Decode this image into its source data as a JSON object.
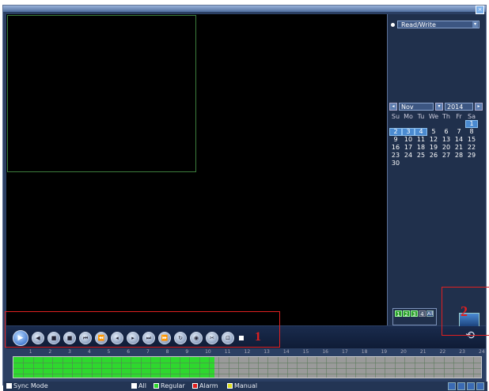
{
  "sidebar": {
    "mode_select": "Read/Write",
    "calendar": {
      "month": "Nov",
      "year": "2014",
      "weekdays": [
        "Su",
        "Mo",
        "Tu",
        "We",
        "Th",
        "Fr",
        "Sa"
      ],
      "days": [
        "1",
        "2",
        "3",
        "4",
        "5",
        "6",
        "7",
        "8",
        "9",
        "10",
        "11",
        "12",
        "13",
        "14",
        "15",
        "16",
        "17",
        "18",
        "19",
        "20",
        "21",
        "22",
        "23",
        "24",
        "25",
        "26",
        "27",
        "28",
        "29",
        "30"
      ],
      "highlighted_days": [
        "1",
        "2",
        "3",
        "4"
      ]
    },
    "channels": [
      "1",
      "2",
      "3",
      "4"
    ],
    "channels_all": "All"
  },
  "controls": {
    "buttons": [
      "play-icon",
      "slow-icon",
      "pause-icon",
      "stop-icon",
      "prev-file-icon",
      "fast-back-icon",
      "frame-back-icon",
      "frame-forward-icon",
      "next-file-icon",
      "fast-forward-icon",
      "loop-icon",
      "snapshot-icon",
      "cut-icon",
      "save-icon"
    ]
  },
  "timeline": {
    "hours": [
      "0",
      "1",
      "2",
      "3",
      "4",
      "5",
      "6",
      "7",
      "8",
      "9",
      "10",
      "11",
      "12",
      "13",
      "14",
      "15",
      "16",
      "17",
      "18",
      "19",
      "20",
      "21",
      "22",
      "23",
      "24"
    ],
    "recorded_fraction": 0.43
  },
  "legend": {
    "sync": "Sync Mode",
    "all": "All",
    "regular": "Regular",
    "alarm": "Alarm",
    "manual": "Manual",
    "colors": {
      "regular": "#2ed82e",
      "alarm": "#e02020",
      "manual": "#e0e020"
    }
  },
  "annotations": {
    "n1": "1",
    "n2": "2"
  }
}
